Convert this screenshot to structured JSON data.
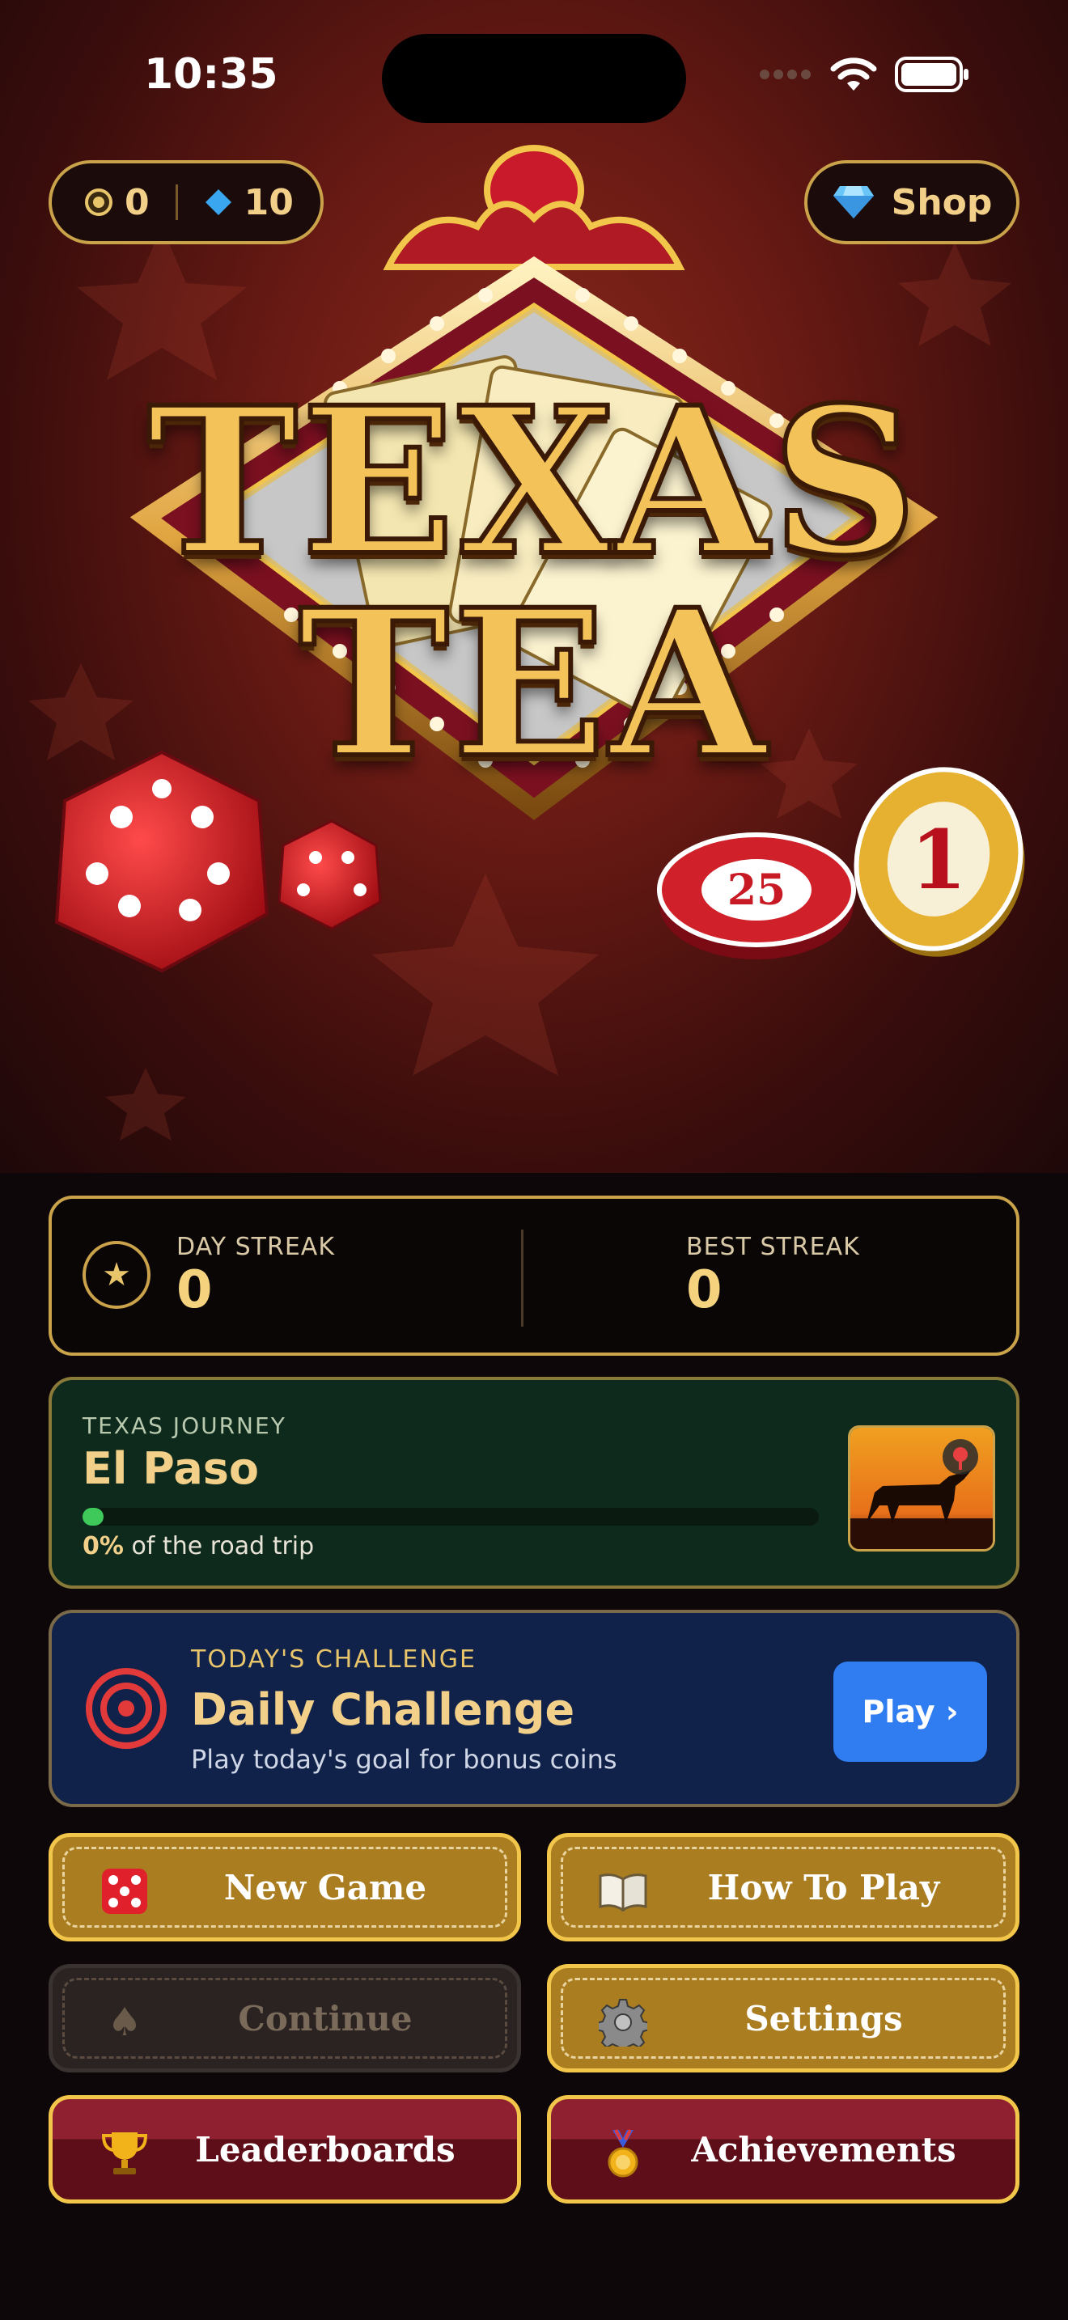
{
  "status": {
    "time": "10:35"
  },
  "currency": {
    "coins": "0",
    "gems": "10"
  },
  "shop": {
    "label": "Shop"
  },
  "logo": {
    "title": "TEXAS TEA"
  },
  "chips": {
    "chip_a": "25",
    "chip_b": "1"
  },
  "streak": {
    "day_label": "DAY STREAK",
    "day_value": "0",
    "best_label": "BEST STREAK",
    "best_value": "0"
  },
  "journey": {
    "label": "TEXAS JOURNEY",
    "city": "El Paso",
    "progress": 0,
    "pct_text": "0%",
    "pct_suffix": "of the road trip"
  },
  "challenge": {
    "label": "TODAY'S CHALLENGE",
    "title": "Daily Challenge",
    "subtitle": "Play today's goal for bonus coins",
    "play_label": "Play ›"
  },
  "buttons": {
    "new_game": "New Game",
    "how_to_play": "How To Play",
    "continue": "Continue",
    "settings": "Settings",
    "leaderboards": "Leaderboards",
    "achievements": "Achievements"
  },
  "icons": {
    "coin": "coin-icon",
    "gem": "gem-icon",
    "diamond": "diamond-icon",
    "star": "star-icon",
    "target": "target-icon",
    "dice": "dice-icon",
    "book": "book-icon",
    "spade": "spade-icon",
    "gear": "gear-icon",
    "trophy": "trophy-icon",
    "medal": "medal-icon"
  },
  "colors": {
    "gold": "#c9a24a",
    "accent_blue": "#2f7df0",
    "progress_green": "#3ec95a"
  }
}
